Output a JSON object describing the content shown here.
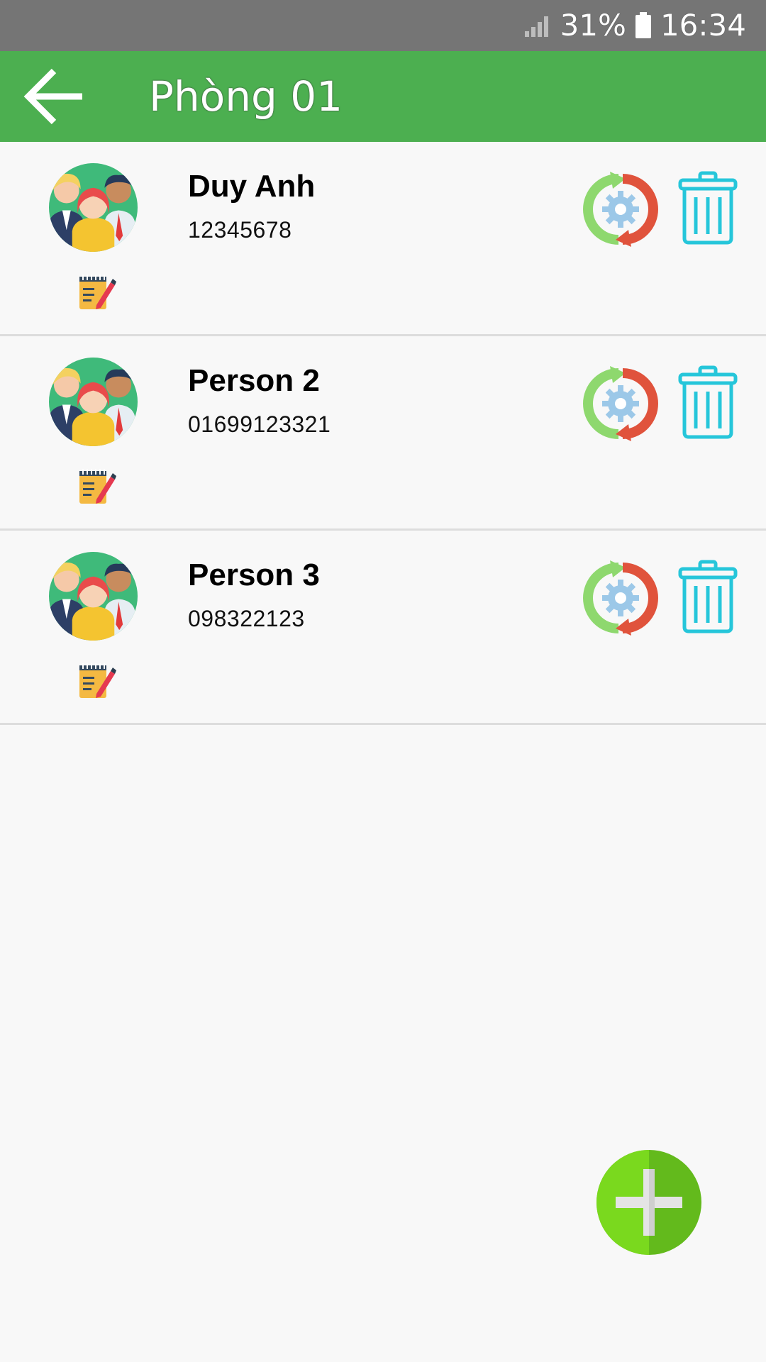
{
  "status_bar": {
    "battery": "31%",
    "time": "16:34",
    "icons": [
      "signal-icon",
      "battery-icon"
    ]
  },
  "app_bar": {
    "title": "Phòng 01",
    "back_icon": "arrow-left-icon"
  },
  "people": [
    {
      "name": "Duy Anh",
      "phone": "12345678"
    },
    {
      "name": "Person 2",
      "phone": "01699123321"
    },
    {
      "name": "Person 3",
      "phone": "098322123"
    }
  ],
  "colors": {
    "status_bar": "#757575",
    "app_bar": "#4caf50",
    "trash": "#26c6da",
    "fab": "#76d21a"
  },
  "fab_icon": "plus-icon"
}
